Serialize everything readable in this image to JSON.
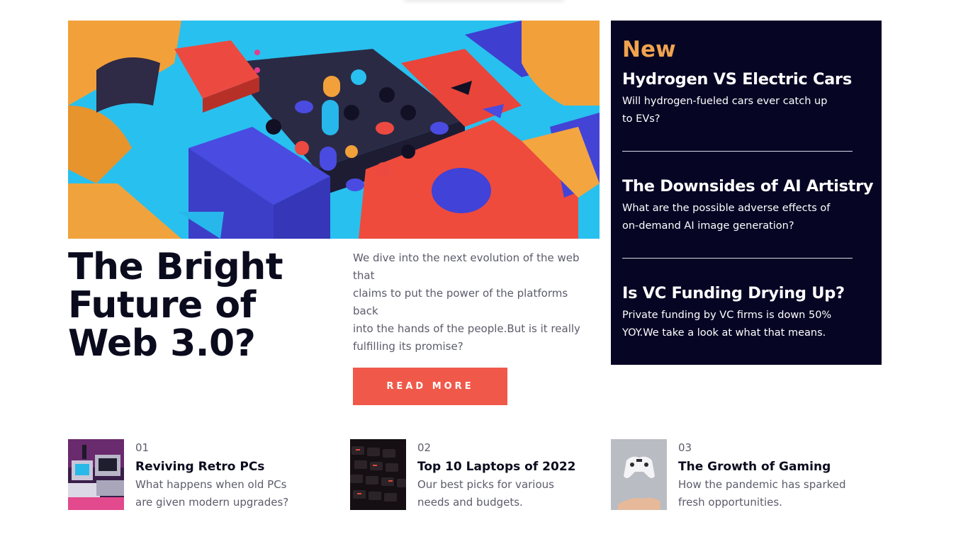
{
  "hero": {
    "title_lines": [
      "The Bright",
      "Future of",
      "Web 3.0?"
    ],
    "description_lines": [
      "We dive into the next evolution of the web",
      "that",
      "claims to put the power of the platforms",
      "back",
      "into the hands of the people.But is it really",
      "fulfilling its promise?"
    ],
    "read_more_label": "READ MORE",
    "image_icon": "abstract-3d-blocks-image"
  },
  "sidebar": {
    "heading": "New",
    "items": [
      {
        "title": "Hydrogen VS Electric Cars",
        "desc_lines": [
          "Will hydrogen-fueled cars ever catch up",
          "to EVs?"
        ]
      },
      {
        "title": "The Downsides of AI Artistry",
        "desc_lines": [
          "What are the possible adverse effects of",
          "on-demand AI image generation?"
        ]
      },
      {
        "title": "Is VC Funding Drying Up?",
        "desc_lines": [
          "Private funding by VC firms is down 50%",
          "YOY.We take a look at what that means."
        ]
      }
    ]
  },
  "cards": [
    {
      "number": "01",
      "title": "Reviving Retro PCs",
      "desc_lines": [
        "What happens when old PCs",
        "are given modern upgrades?"
      ],
      "image_icon": "retro-pc-image"
    },
    {
      "number": "02",
      "title": "Top 10 Laptops of 2022",
      "desc_lines": [
        "Our best picks for various",
        "needs and budgets."
      ],
      "image_icon": "keyboard-image"
    },
    {
      "number": "03",
      "title": "The Growth of Gaming",
      "desc_lines": [
        "How the pandemic has sparked",
        "fresh opportunities."
      ],
      "image_icon": "game-controller-image"
    }
  ],
  "colors": {
    "accent": "#f0594a",
    "sidebar_bg": "#060524",
    "new_label": "#f0a34e",
    "headline": "#0b0b1e",
    "body_text": "#5c5c6c"
  }
}
